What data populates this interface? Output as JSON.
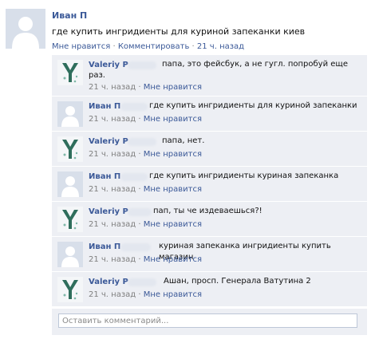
{
  "post": {
    "author": "Иван П",
    "text": "где купить ингридиенты для куриной запеканки киев",
    "like": "Мне нравится",
    "comment": "Комментировать",
    "time": "21 ч. назад",
    "sep": "·"
  },
  "comments": [
    {
      "author": "Valeriy P",
      "line1": "папа, это фейсбук, а не гугл. попробуй еще",
      "line2": "раз.",
      "time": "21 ч. назад",
      "like": "Мне нравится"
    },
    {
      "author": "Иван П",
      "line1": "где купить ингридиенты для куриной запеканки",
      "line2": "",
      "time": "21 ч. назад",
      "like": "Мне нравится"
    },
    {
      "author": "Valeriy P",
      "line1": "папа, нет.",
      "line2": "",
      "time": "21 ч. назад",
      "like": "Мне нравится"
    },
    {
      "author": "Иван П",
      "line1": "где купить ингридиенты куриная запеканка",
      "line2": "",
      "time": "21 ч. назад",
      "like": "Мне нравится"
    },
    {
      "author": "Valeriy P",
      "line1": "пап, ты че издеваешься?!",
      "line2": "",
      "time": "21 ч. назад",
      "like": "Мне нравится"
    },
    {
      "author": "Иван П",
      "line1": "куриная запеканка ингридиенты купить магазин",
      "line2": "",
      "time": "21 ч. назад",
      "like": "Мне нравится"
    },
    {
      "author": "Valeriy P",
      "line1": "Ашан, просп. Генерала Ватутина 2",
      "line2": "",
      "time": "21 ч. назад",
      "like": "Мне нравится"
    }
  ],
  "input": {
    "placeholder": "Оставить комментарий..."
  },
  "colors": {
    "link": "#3b5998",
    "comment_bg": "#edeff4",
    "meta": "#7f7f7f"
  }
}
